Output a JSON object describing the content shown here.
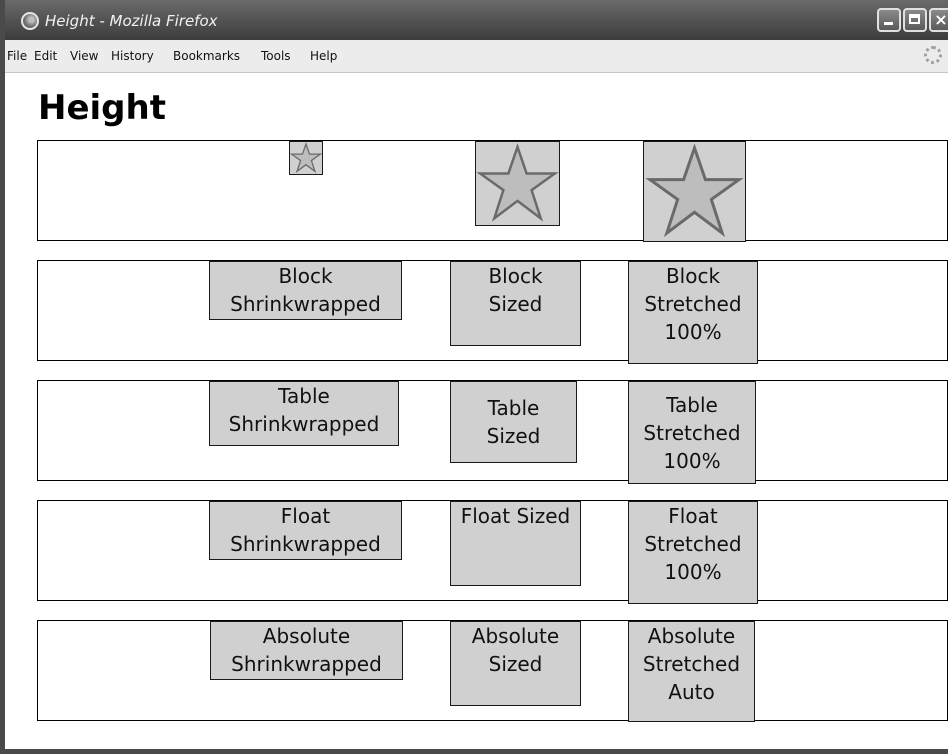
{
  "window": {
    "title": "Height - Mozilla Firefox",
    "buttons": {
      "minimize": "minimize-icon",
      "maximize": "maximize-icon",
      "close": "×"
    }
  },
  "menu": [
    "File",
    "Edit",
    "View",
    "History",
    "Bookmarks",
    "Tools",
    "Help"
  ],
  "page": {
    "heading": "Height",
    "rows": [
      {
        "kind": "image",
        "items": [
          "star-icon",
          "star-icon",
          "star-icon"
        ]
      },
      {
        "kind": "block",
        "items": [
          {
            "lines": [
              "Block",
              "Shrinkwrapped"
            ]
          },
          {
            "lines": [
              "Block",
              "Sized"
            ]
          },
          {
            "lines": [
              "Block",
              "Stretched",
              "100%"
            ]
          }
        ]
      },
      {
        "kind": "table",
        "items": [
          {
            "lines": [
              "Table",
              "Shrinkwrapped"
            ]
          },
          {
            "lines": [
              "Table",
              "Sized"
            ]
          },
          {
            "lines": [
              "Table",
              "Stretched",
              "100%"
            ]
          }
        ]
      },
      {
        "kind": "float",
        "items": [
          {
            "lines": [
              "Float",
              "Shrinkwrapped"
            ]
          },
          {
            "lines": [
              "Float Sized"
            ]
          },
          {
            "lines": [
              "Float",
              "Stretched",
              "100%"
            ]
          }
        ]
      },
      {
        "kind": "absolute",
        "items": [
          {
            "lines": [
              "Absolute",
              "Shrinkwrapped"
            ]
          },
          {
            "lines": [
              "Absolute",
              "Sized"
            ]
          },
          {
            "lines": [
              "Absolute",
              "Stretched",
              "Auto"
            ]
          }
        ]
      }
    ]
  }
}
